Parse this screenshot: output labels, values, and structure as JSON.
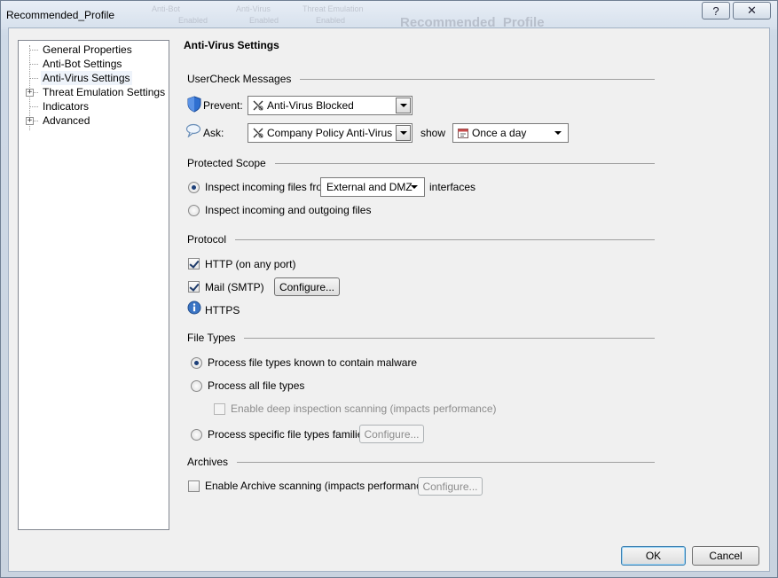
{
  "window": {
    "title": "Recommended_Profile",
    "help_glyph": "?",
    "close_glyph": "✕",
    "background_ghost": {
      "columns": [
        "Anti-Bot",
        "Anti-Virus",
        "Threat Emulation"
      ],
      "cells": [
        "Enabled",
        "Enabled",
        "Enabled"
      ],
      "heading": "Recommended_Profile"
    }
  },
  "tree": {
    "items": [
      {
        "label": "General Properties",
        "expandable": false,
        "selected": false
      },
      {
        "label": "Anti-Bot Settings",
        "expandable": false,
        "selected": false
      },
      {
        "label": "Anti-Virus Settings",
        "expandable": false,
        "selected": true
      },
      {
        "label": "Threat Emulation Settings",
        "expandable": true,
        "selected": false
      },
      {
        "label": "Indicators",
        "expandable": false,
        "selected": false
      },
      {
        "label": "Advanced",
        "expandable": true,
        "selected": false
      }
    ],
    "expander_glyph": "+"
  },
  "panel": {
    "title": "Anti-Virus Settings",
    "usercheck": {
      "heading": "UserCheck Messages",
      "prevent_label": "Prevent:",
      "prevent_value": "Anti-Virus Blocked",
      "ask_label": "Ask:",
      "ask_value": "Company Policy Anti-Virus",
      "show_label": "show",
      "frequency_value": "Once a day"
    },
    "scope": {
      "heading": "Protected Scope",
      "option_incoming": "Inspect incoming files from:",
      "interfaces_value": "External and DMZ",
      "interfaces_suffix": "interfaces",
      "option_both": "Inspect incoming and outgoing files",
      "selected": "incoming"
    },
    "protocol": {
      "heading": "Protocol",
      "http_label": "HTTP (on any port)",
      "http_checked": true,
      "mail_label": "Mail (SMTP)",
      "mail_checked": true,
      "configure_label": "Configure...",
      "https_label": "HTTPS"
    },
    "filetypes": {
      "heading": "File Types",
      "option_known": "Process file types known to contain malware",
      "option_all": "Process all file types",
      "deep_inspection": "Enable deep inspection scanning (impacts performance)",
      "option_specific": "Process specific file types families",
      "configure_label": "Configure...",
      "selected": "known"
    },
    "archives": {
      "heading": "Archives",
      "enable_label": "Enable Archive scanning (impacts performance)",
      "enable_checked": false,
      "configure_label": "Configure..."
    }
  },
  "footer": {
    "ok_label": "OK",
    "cancel_label": "Cancel"
  },
  "colors": {
    "shield": "#2f6fd0",
    "info": "#3a74c4",
    "radio_dot": "#1c3f78"
  }
}
